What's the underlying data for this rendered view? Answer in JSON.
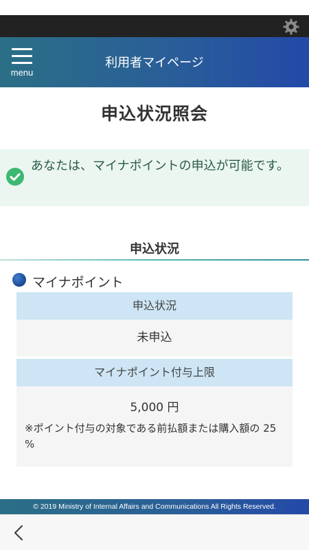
{
  "header": {
    "menu_label": "menu",
    "title": "利用者マイページ",
    "settings_icon": "gear-icon",
    "menu_icon": "hamburger-menu-icon"
  },
  "page": {
    "title": "申込状況照会"
  },
  "notice": {
    "icon": "check-circle-icon",
    "text": "あなたは、マイナポイントの申込が可能です。",
    "color": "#3cb873"
  },
  "section": {
    "title": "申込状況"
  },
  "mynapoint": {
    "label": "マイナポイント",
    "icon": "mynapoint-logo-icon",
    "table": {
      "status_header": "申込状況",
      "status_value": "未申込",
      "limit_header": "マイナポイント付与上限",
      "limit_value": "5,000 円",
      "limit_note": "※ポイント付与の対象である前払額または購入額の 25 %"
    }
  },
  "footer": {
    "copyright": "© 2019 Ministry of Internal Affairs and Communications All Rights Reserved."
  },
  "nav": {
    "back_icon": "chevron-left-icon"
  },
  "colors": {
    "brand_start": "#2b6f86",
    "brand_end": "#2449a8",
    "table_header_bg": "#cde5f4",
    "notice_bg": "#ebf6f1"
  }
}
